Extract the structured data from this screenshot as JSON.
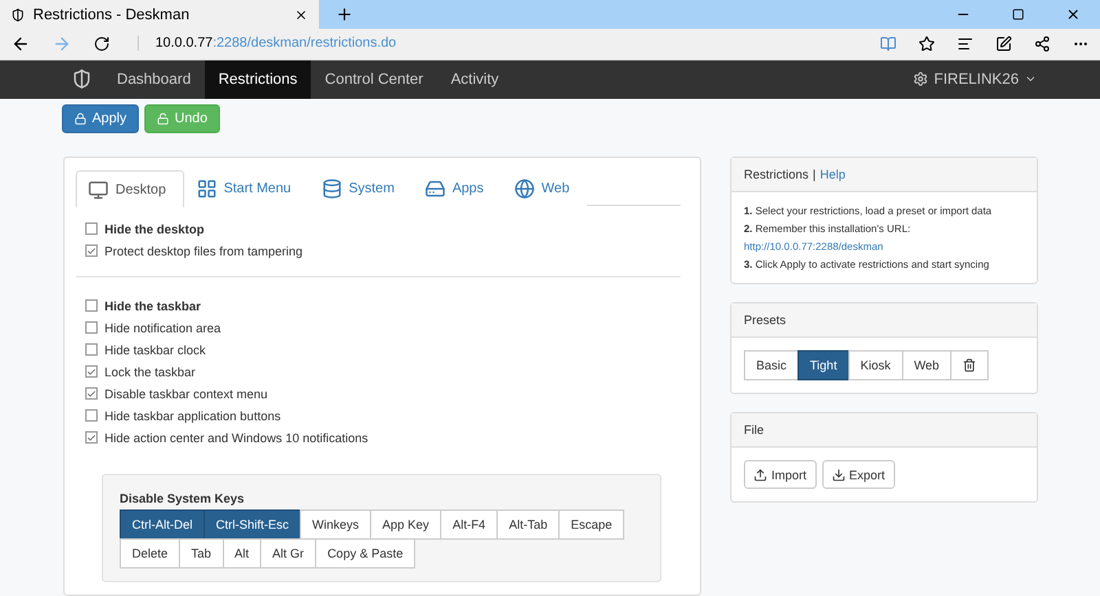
{
  "browser": {
    "tab_title": "Restrictions - Deskman",
    "url_host": "10.0.0.77",
    "url_path": ":2288/deskman/restrictions.do"
  },
  "nav": {
    "items": [
      {
        "label": "Dashboard",
        "selected": false
      },
      {
        "label": "Restrictions",
        "selected": true
      },
      {
        "label": "Control Center",
        "selected": false
      },
      {
        "label": "Activity",
        "selected": false
      }
    ],
    "user": "FIRELINK26"
  },
  "actions": [
    {
      "label": "Apply",
      "kind": "primary"
    },
    {
      "label": "Undo",
      "kind": "success"
    }
  ],
  "tabs": [
    {
      "label": "Desktop",
      "selected": true
    },
    {
      "label": "Start Menu",
      "selected": false
    },
    {
      "label": "System",
      "selected": false
    },
    {
      "label": "Apps",
      "selected": false
    },
    {
      "label": "Web",
      "selected": false
    }
  ],
  "option_groups": [
    [
      {
        "label": "Hide the desktop",
        "checked": false,
        "bold": true
      },
      {
        "label": "Protect desktop files from tampering",
        "checked": true,
        "bold": false
      }
    ],
    [
      {
        "label": "Hide the taskbar",
        "checked": false,
        "bold": true
      },
      {
        "label": "Hide notification area",
        "checked": false,
        "bold": false
      },
      {
        "label": "Hide taskbar clock",
        "checked": false,
        "bold": false
      },
      {
        "label": "Lock the taskbar",
        "checked": true,
        "bold": false
      },
      {
        "label": "Disable taskbar context menu",
        "checked": true,
        "bold": false
      },
      {
        "label": "Hide taskbar application buttons",
        "checked": false,
        "bold": false
      },
      {
        "label": "Hide action center and Windows 10 notifications",
        "checked": true,
        "bold": false
      }
    ]
  ],
  "system_keys": {
    "title": "Disable System Keys",
    "keys": [
      {
        "label": "Ctrl-Alt-Del",
        "selected": true
      },
      {
        "label": "Ctrl-Shift-Esc",
        "selected": true
      },
      {
        "label": "Winkeys",
        "selected": false
      },
      {
        "label": "App Key",
        "selected": false
      },
      {
        "label": "Alt-F4",
        "selected": false
      },
      {
        "label": "Alt-Tab",
        "selected": false
      },
      {
        "label": "Escape",
        "selected": false
      },
      {
        "label": "Delete",
        "selected": false
      },
      {
        "label": "Tab",
        "selected": false
      },
      {
        "label": "Alt",
        "selected": false
      },
      {
        "label": "Alt Gr",
        "selected": false
      },
      {
        "label": "Copy & Paste",
        "selected": false
      }
    ]
  },
  "info_panel": {
    "title": "Restrictions",
    "separator": "|",
    "help": "Help",
    "steps": [
      "**1.** Select your restrictions, load a preset or import data",
      "**2.** Remember this installation's URL:"
    ],
    "url": "http://10.0.0.77:2288/deskman",
    "last_step": "**3.** Click Apply to activate restrictions and start syncing"
  },
  "presets": {
    "title": "Presets",
    "items": [
      {
        "label": "Basic",
        "selected": false
      },
      {
        "label": "Tight",
        "selected": true
      },
      {
        "label": "Kiosk",
        "selected": false
      },
      {
        "label": "Web",
        "selected": false
      }
    ]
  },
  "file": {
    "title": "File",
    "buttons": [
      "Import",
      "Export"
    ]
  }
}
